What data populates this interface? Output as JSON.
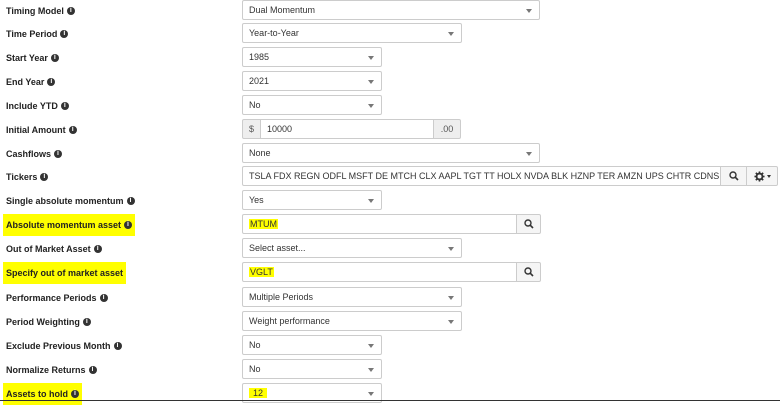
{
  "fields": {
    "timing_model": {
      "label": "Timing Model",
      "value": "Dual Momentum"
    },
    "time_period": {
      "label": "Time Period",
      "value": "Year-to-Year"
    },
    "start_year": {
      "label": "Start Year",
      "value": "1985"
    },
    "end_year": {
      "label": "End Year",
      "value": "2021"
    },
    "include_ytd": {
      "label": "Include YTD",
      "value": "No"
    },
    "initial_amount": {
      "label": "Initial Amount",
      "prefix": "$",
      "value": "10000",
      "suffix": ".00"
    },
    "cashflows": {
      "label": "Cashflows",
      "value": "None"
    },
    "tickers": {
      "label": "Tickers",
      "value": "TSLA FDX REGN ODFL MSFT DE MTCH CLX AAPL TGT TT HOLX NVDA BLK HZNP TER AMZN UPS CHTR CDNS CSGP NVR"
    },
    "single_absolute_momentum": {
      "label": "Single absolute momentum",
      "value": "Yes"
    },
    "absolute_momentum_asset": {
      "label": "Absolute momentum asset",
      "value": "MTUM"
    },
    "out_of_market_asset": {
      "label": "Out of Market Asset",
      "placeholder": "Select asset..."
    },
    "specify_out_of_market_asset": {
      "label": "Specify out of market asset",
      "value": "VGLT"
    },
    "performance_periods": {
      "label": "Performance Periods",
      "value": "Multiple Periods"
    },
    "period_weighting": {
      "label": "Period Weighting",
      "value": "Weight performance"
    },
    "exclude_previous_month": {
      "label": "Exclude Previous Month",
      "value": "No"
    },
    "normalize_returns": {
      "label": "Normalize Returns",
      "value": "No"
    },
    "assets_to_hold": {
      "label": "Assets to hold",
      "value": "12"
    }
  },
  "icons": {
    "info": "info-circle-icon",
    "search": "search-icon",
    "gear": "gear-icon",
    "caret": "caret-down-icon"
  },
  "colors": {
    "highlight": "#ffff00",
    "border": "#cccccc"
  }
}
